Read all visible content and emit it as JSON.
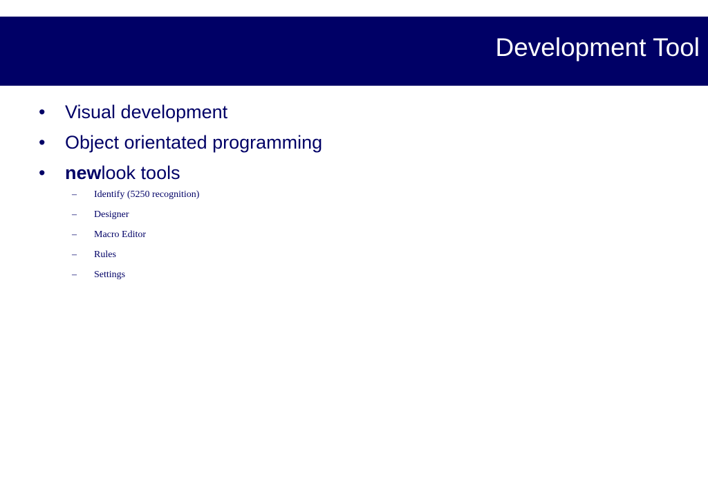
{
  "slide": {
    "title": "Development Tool",
    "bullets": [
      {
        "marker": "•",
        "text": "Visual development"
      },
      {
        "marker": "•",
        "text": "Object orientated programming"
      },
      {
        "marker": "•",
        "bold": "new",
        "text": "look tools"
      }
    ],
    "subbullets": [
      {
        "marker": "–",
        "text": "Identify (5250 recognition)"
      },
      {
        "marker": "–",
        "text": "Designer"
      },
      {
        "marker": "–",
        "text": "Macro Editor"
      },
      {
        "marker": "–",
        "text": "Rules"
      },
      {
        "marker": "–",
        "text": "Settings"
      }
    ]
  },
  "colors": {
    "title_bar": "#000066",
    "title_text": "#ffffff",
    "body_text": "#000066",
    "background": "#ffffff"
  }
}
